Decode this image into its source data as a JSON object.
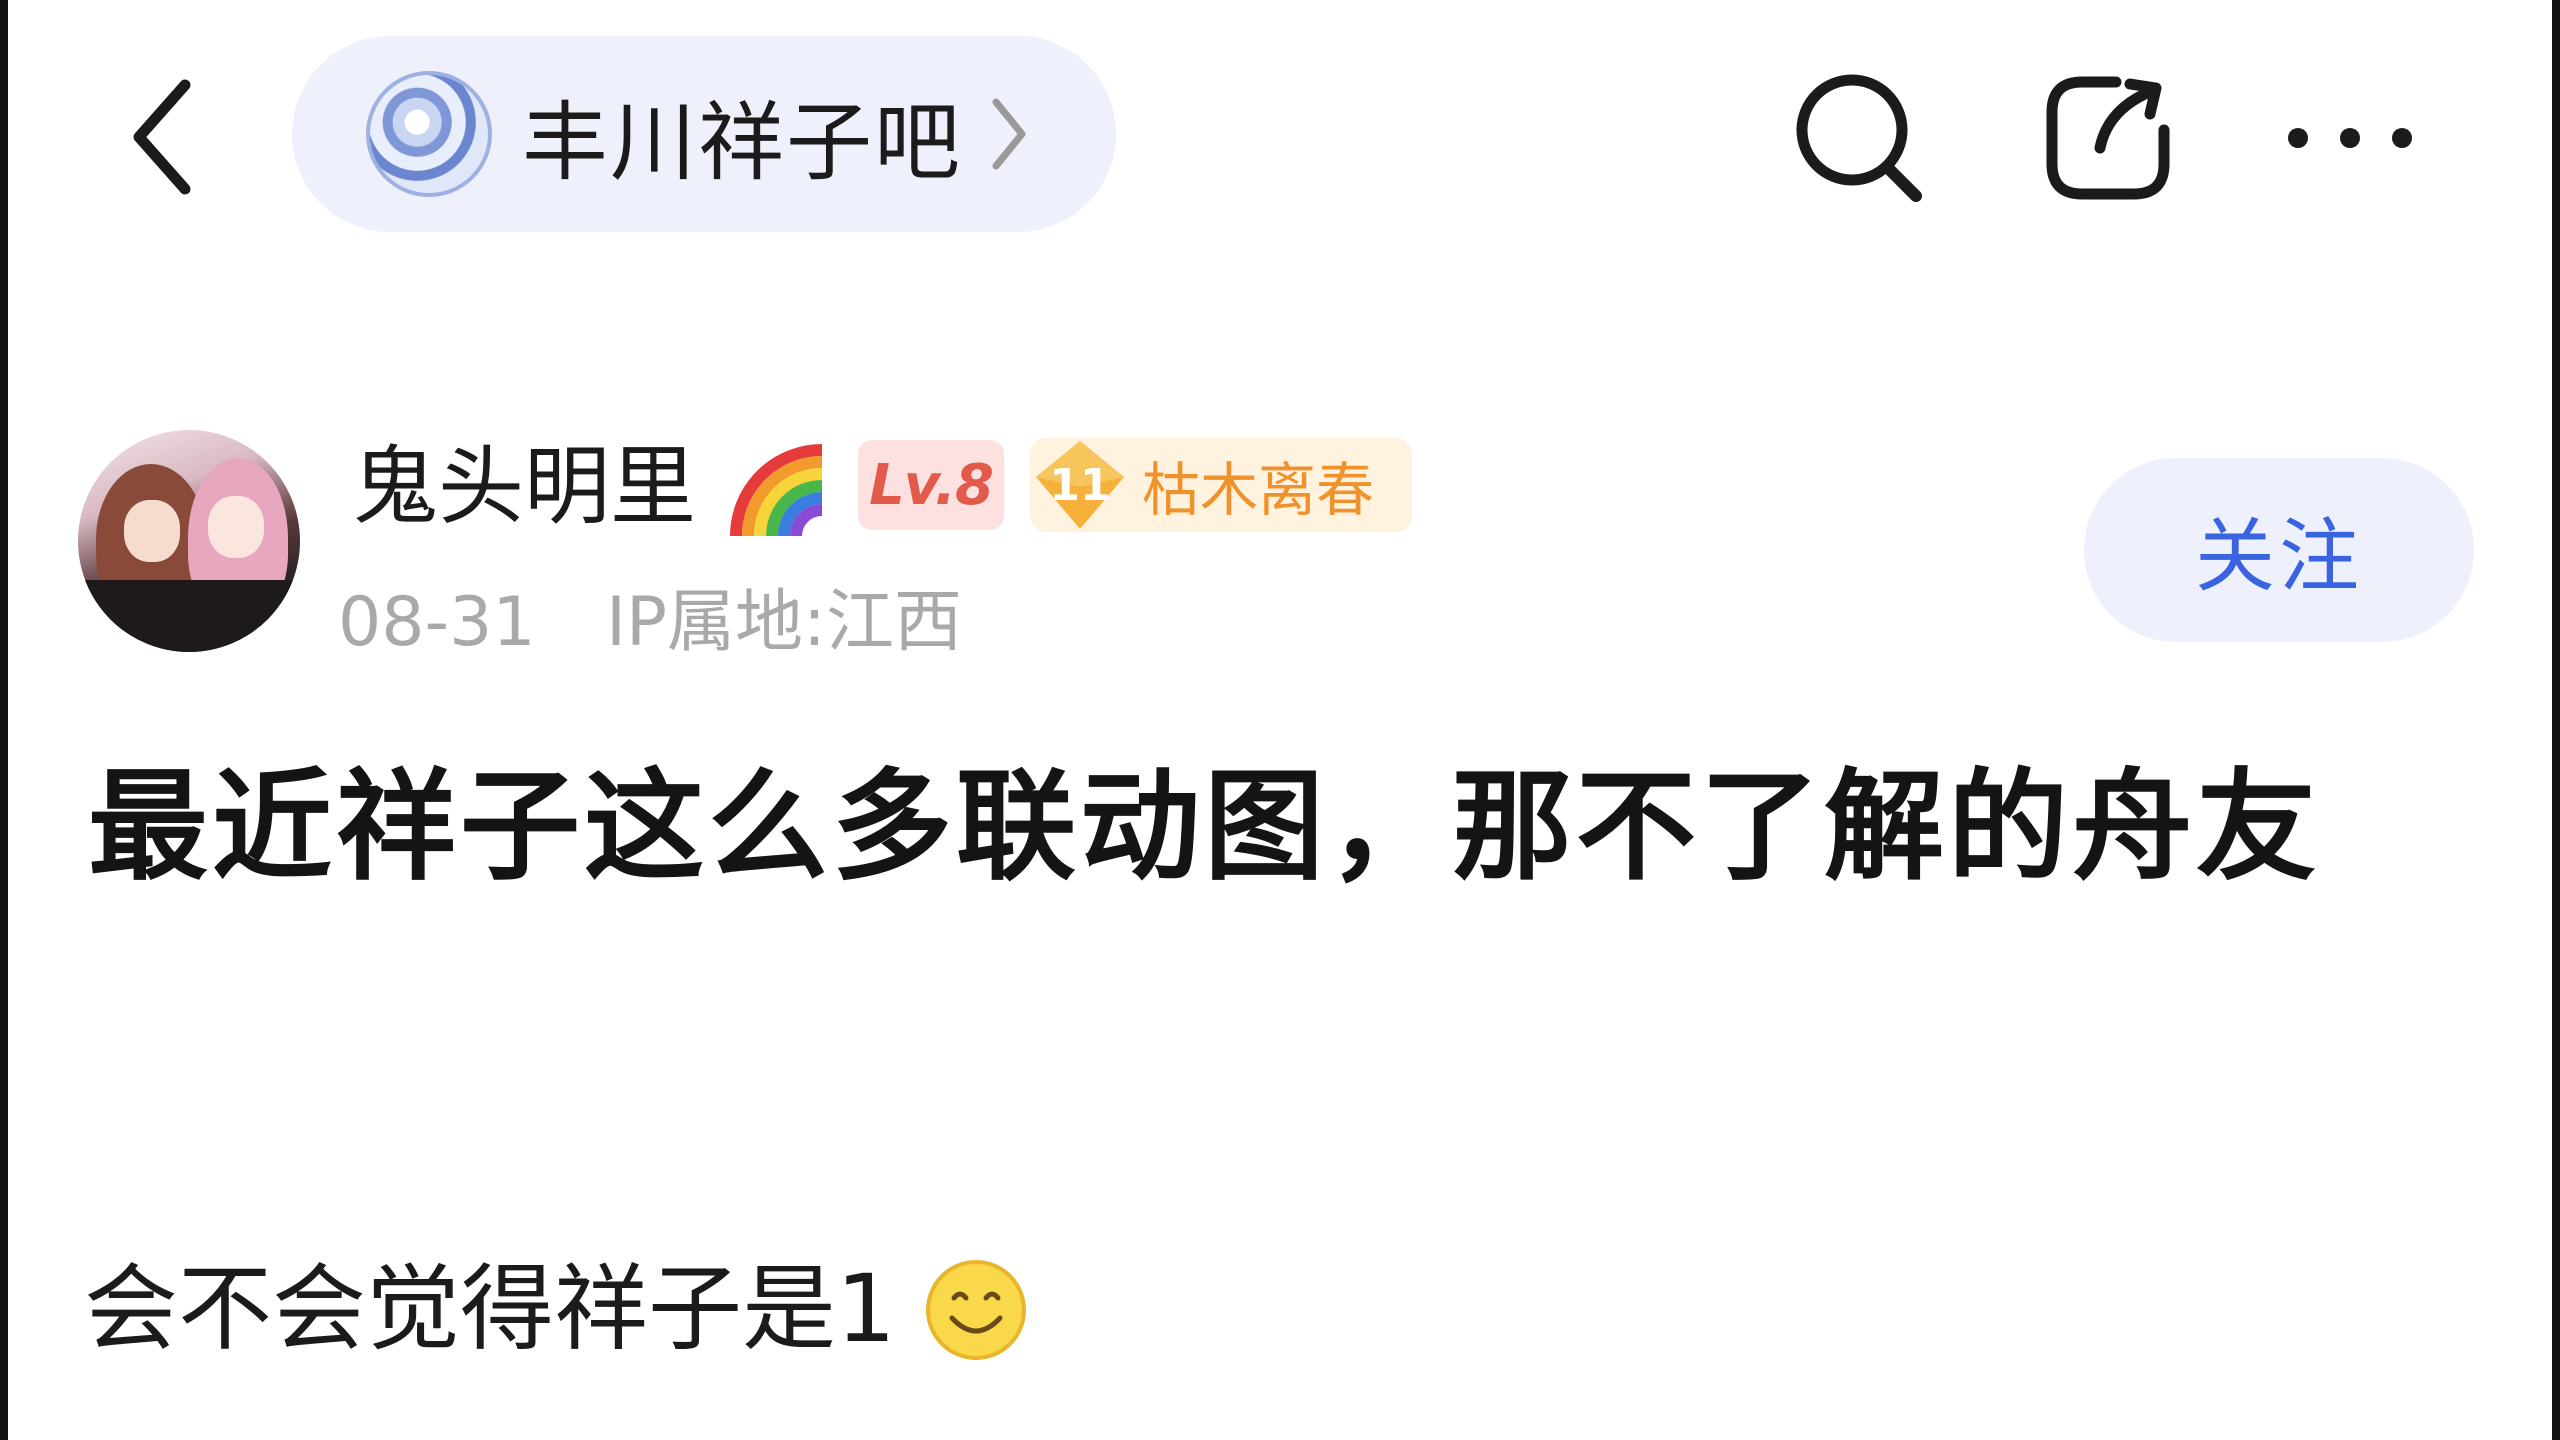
{
  "header": {
    "forum_name": "丰川祥子吧"
  },
  "author": {
    "name": "鬼头明里",
    "level_badge": "Lv.8",
    "rank_level": "11",
    "rank_title": "枯木离春",
    "date": "08-31",
    "ip_location": "IP属地:江西",
    "follow_label": "关注"
  },
  "post": {
    "title": "最近祥子这么多联动图，那不了解的舟友",
    "body": "会不会觉得祥子是1"
  },
  "icons": {
    "back": "chevron-left-icon",
    "forum_more": "chevron-right-icon",
    "search": "search-icon",
    "share": "share-icon",
    "more": "more-icon",
    "badge": "rainbow-icon",
    "emoji": "smile-emoji-icon"
  },
  "colors": {
    "accent": "#3a63e0",
    "pill_bg": "#eef0fb",
    "level_badge_text": "#e25a4a",
    "rank_text": "#f0922b",
    "meta_text": "#a9a9a9"
  }
}
